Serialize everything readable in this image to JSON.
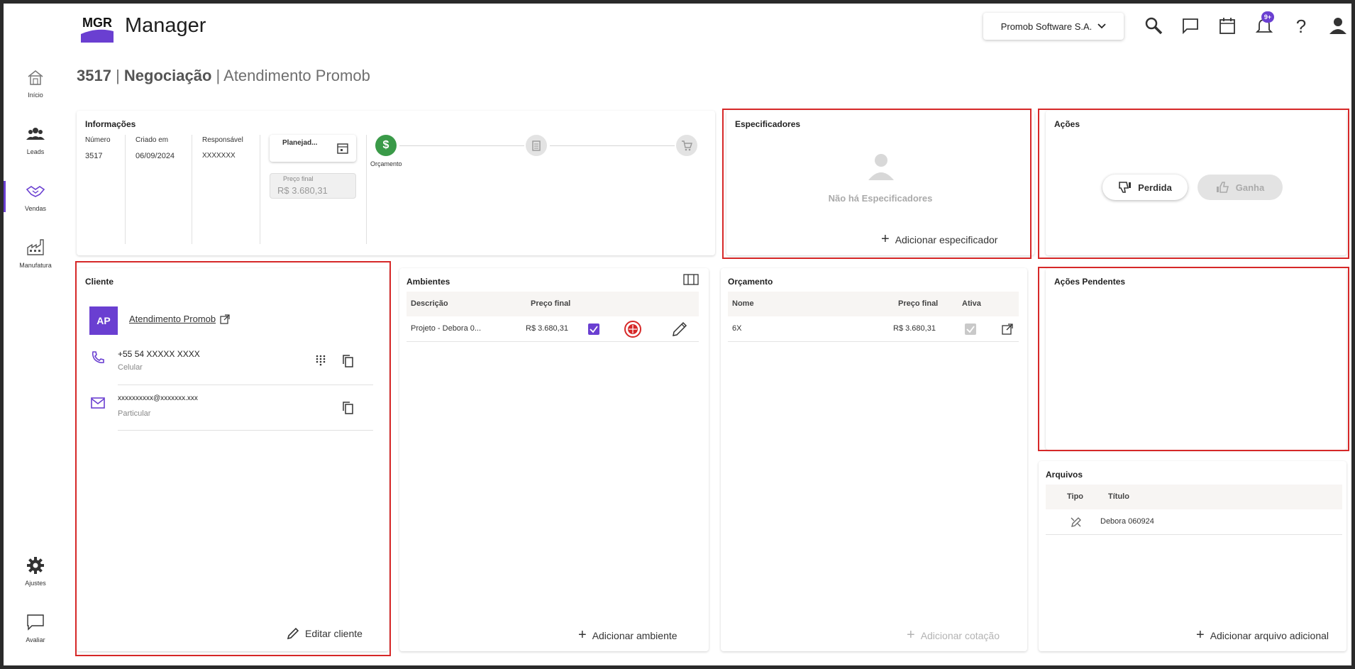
{
  "app": {
    "brand": "Manager",
    "logo_text": "MGR"
  },
  "header": {
    "company": "Promob Software S.A.",
    "notifications_badge": "9+"
  },
  "sidebar": {
    "items": [
      {
        "label": "Início"
      },
      {
        "label": "Leads"
      },
      {
        "label": "Vendas"
      },
      {
        "label": "Manufatura"
      },
      {
        "label": "Ajustes"
      },
      {
        "label": "Avaliar"
      }
    ]
  },
  "page": {
    "number": "3517",
    "sep1": " | ",
    "stage": "Negociação",
    "sep2": " | ",
    "subject": "Atendimento Promob"
  },
  "info": {
    "title": "Informações",
    "labels": {
      "numero": "Número",
      "criado": "Criado em",
      "responsavel": "Responsável"
    },
    "values": {
      "numero": "3517",
      "criado": "06/09/2024",
      "responsavel": "XXXXXXX"
    },
    "status_value": "Planejad...",
    "price_label": "Preço final",
    "price_value": "R$ 3.680,31",
    "step_label": "Orçamento"
  },
  "specifiers": {
    "title": "Especificadores",
    "empty": "Não há Especificadores",
    "add": "Adicionar especificador"
  },
  "actions": {
    "title": "Ações",
    "lost": "Perdida",
    "won": "Ganha"
  },
  "pending": {
    "title": "Ações Pendentes"
  },
  "client": {
    "title": "Cliente",
    "initials": "AP",
    "name": "Atendimento Promob",
    "phone": "+55 54 XXXXX XXXX",
    "phone_type": "Celular",
    "email": "xxxxxxxxxx@xxxxxxx.xxx",
    "email_type": "Particular",
    "edit": "Editar cliente"
  },
  "environments": {
    "title": "Ambientes",
    "headers": {
      "desc": "Descrição",
      "price": "Preço final"
    },
    "rows": [
      {
        "desc": "Projeto - Debora 0...",
        "price": "R$ 3.680,31"
      }
    ],
    "add": "Adicionar ambiente"
  },
  "budget": {
    "title": "Orçamento",
    "headers": {
      "name": "Nome",
      "price": "Preço final",
      "active": "Ativa"
    },
    "rows": [
      {
        "name": "6X",
        "price": "R$ 3.680,31"
      }
    ],
    "add": "Adicionar cotação"
  },
  "files": {
    "title": "Arquivos",
    "headers": {
      "type": "Tipo",
      "title": "Título"
    },
    "rows": [
      {
        "title": "Debora 060924"
      }
    ],
    "add": "Adicionar arquivo adicional"
  },
  "colors": {
    "accent": "#6a3fd1",
    "success": "#3a9a48",
    "highlight": "#d62828"
  }
}
